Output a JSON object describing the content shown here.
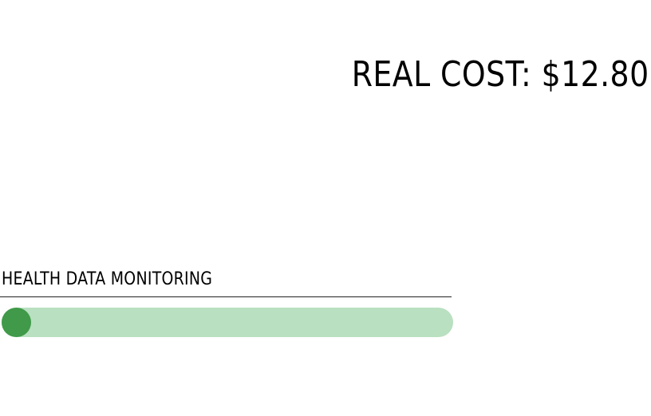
{
  "header": {
    "real_cost_text": "REAL COST: $12.80"
  },
  "health_data": {
    "title": "HEALTH DATA MONITORING",
    "slider_value": 0
  },
  "colors": {
    "track": "#b9e0c0",
    "knob": "#409a49",
    "text": "#000000"
  }
}
